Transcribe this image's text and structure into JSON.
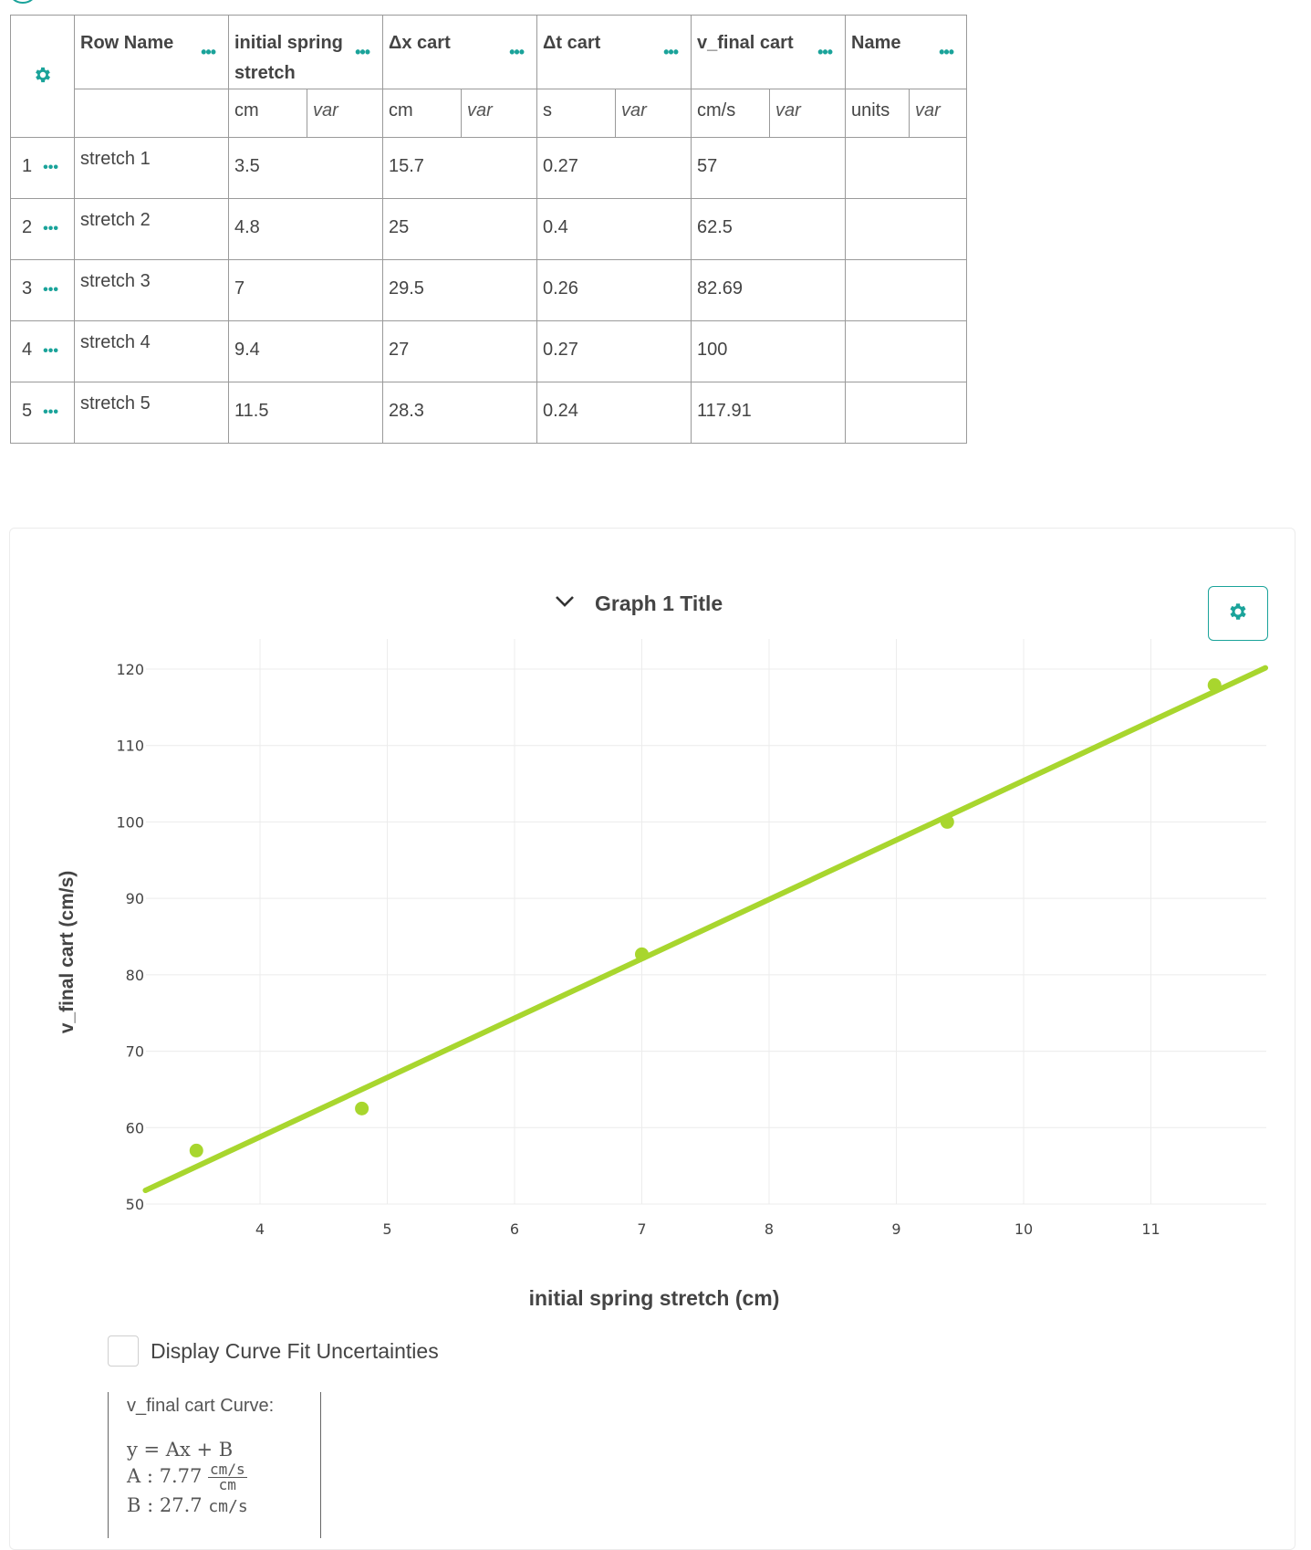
{
  "table": {
    "columns": [
      {
        "name": "Row Name",
        "unit": "",
        "var": ""
      },
      {
        "name": "initial spring stretch",
        "unit": "cm",
        "var": "var"
      },
      {
        "name": "Δx cart",
        "unit": "cm",
        "var": "var"
      },
      {
        "name": "Δt cart",
        "unit": "s",
        "var": "var"
      },
      {
        "name": "v_final cart",
        "unit": "cm/s",
        "var": "var"
      },
      {
        "name": "Name",
        "unit": "units",
        "var": "var"
      }
    ],
    "rows": [
      {
        "num": "1",
        "name": "stretch 1",
        "stretch": "3.5",
        "dx": "15.7",
        "dt": "0.27",
        "v": "57",
        "extra": ""
      },
      {
        "num": "2",
        "name": "stretch 2",
        "stretch": "4.8",
        "dx": "25",
        "dt": "0.4",
        "v": "62.5",
        "extra": ""
      },
      {
        "num": "3",
        "name": "stretch 3",
        "stretch": "7",
        "dx": "29.5",
        "dt": "0.26",
        "v": "82.69",
        "extra": ""
      },
      {
        "num": "4",
        "name": "stretch 4",
        "stretch": "9.4",
        "dx": "27",
        "dt": "0.27",
        "v": "100",
        "extra": ""
      },
      {
        "num": "5",
        "name": "stretch 5",
        "stretch": "11.5",
        "dx": "28.3",
        "dt": "0.24",
        "v": "117.91",
        "extra": ""
      }
    ]
  },
  "graph": {
    "title": "Graph 1 Title",
    "uncertainty_label": "Display Curve Fit Uncertainties",
    "curve_title": "v_final cart Curve:",
    "equation": "y = Ax + B",
    "A_label": "A : 7.77",
    "A_unit_num": "cm/s",
    "A_unit_den": "cm",
    "B_label": "B : 27.7",
    "B_unit": "cm/s"
  },
  "colors": {
    "accent": "#1aa39a",
    "series": "#a8d62e"
  },
  "chart_data": {
    "type": "scatter",
    "xlabel": "initial spring stretch (cm)",
    "ylabel": "v_final cart (cm/s)",
    "xlim": [
      3.1,
      11.9
    ],
    "ylim": [
      50,
      120
    ],
    "xticks": [
      "4",
      "5",
      "6",
      "7",
      "8",
      "9",
      "10",
      "11"
    ],
    "yticks": [
      "50",
      "60",
      "70",
      "80",
      "90",
      "100",
      "110",
      "120"
    ],
    "series": [
      {
        "name": "v_final cart",
        "x": [
          3.5,
          4.8,
          7,
          9.4,
          11.5
        ],
        "y": [
          57,
          62.5,
          82.69,
          100,
          117.91
        ]
      }
    ],
    "fit": {
      "type": "linear",
      "A": 7.77,
      "B": 27.7
    },
    "grid": true
  }
}
